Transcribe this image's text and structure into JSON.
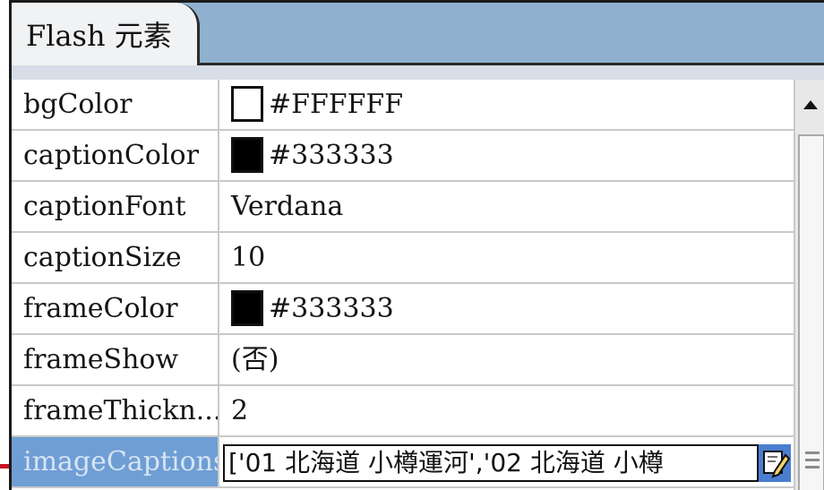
{
  "panel": {
    "tab_label": "Flash 元素"
  },
  "properties": [
    {
      "name": "bgColor",
      "value": "#FFFFFF",
      "swatch": "#FFFFFF"
    },
    {
      "name": "captionColor",
      "value": "#333333",
      "swatch": "#333333"
    },
    {
      "name": "captionFont",
      "value": "Verdana"
    },
    {
      "name": "captionSize",
      "value": "10"
    },
    {
      "name": "frameColor",
      "value": "#333333",
      "swatch": "#333333"
    },
    {
      "name": "frameShow",
      "value": "(否)"
    },
    {
      "name": "frameThickn...",
      "value": "2"
    },
    {
      "name": "imageCaptions",
      "value": "['01 北海道 小樽運河','02 北海道 小樽",
      "selected": true
    }
  ],
  "icons": {
    "scroll_up": "triangle-up-icon",
    "edit": "edit-pencil-icon",
    "grip": "scroll-grip-icon"
  },
  "colors": {
    "tab_bar": "#8FB1CF",
    "selected_row": "#6F9ED4",
    "callout_line": "#C91320"
  }
}
